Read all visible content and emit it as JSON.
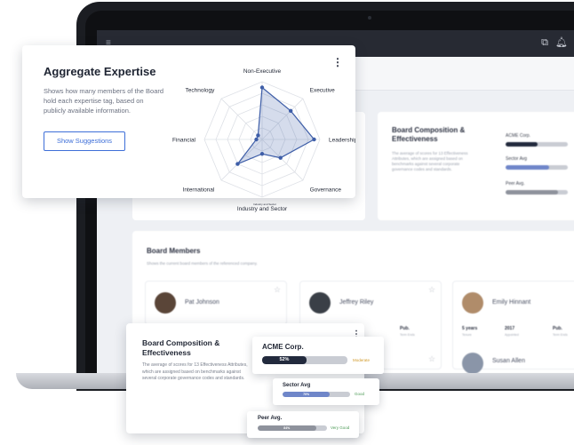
{
  "expertise_card": {
    "title": "Aggregate Expertise",
    "description": "Shows how many members of the Board hold each expertise tag, based on publicly available information.",
    "button_label": "Show Suggestions",
    "axes": [
      "Non-Executive",
      "Executive",
      "Leadership",
      "Governance",
      "Industry and Sector",
      "International",
      "Financial",
      "Technology"
    ],
    "axis_values": [
      0.9,
      0.7,
      0.9,
      0.45,
      0.25,
      0.6,
      0.1,
      0.1
    ],
    "fill_color": "#3e5ea8",
    "small_caption": "Industry and Sector"
  },
  "bg_composition": {
    "title": "Board Composition & Effectiveness",
    "description": "The average of scores for 13 Effectiveness Attributes, which are assigned based on benchmarks against several corporate governance codes and standards.",
    "rows": [
      {
        "label": "ACME Corp.",
        "value": "52%",
        "fraction": 0.52,
        "color": "#222a3d"
      },
      {
        "label": "Sector Avg",
        "value": "70%",
        "fraction": 0.7,
        "color": "#6f86c9"
      },
      {
        "label": "Peer Avg.",
        "value": "84%",
        "fraction": 0.84,
        "color": "#8e929c"
      }
    ]
  },
  "board_members": {
    "title": "Board Members",
    "description": "Shows the current board members of the referenced company.",
    "members": [
      {
        "name": "Pat Johnson",
        "avatar_color": "#5a4538"
      },
      {
        "name": "Jeffrey Riley",
        "avatar_color": "#3a3f47"
      },
      {
        "name": "Emily Hinnant",
        "avatar_color": "#b08c6a"
      }
    ],
    "stats": [
      {
        "value": "5 years",
        "label": "Tenure"
      },
      {
        "value": "2017",
        "label": "Appointed"
      },
      {
        "value": "Pub.",
        "label": "Term Ends"
      }
    ],
    "partial_stat": {
      "value": "Pub.",
      "label": "Term Ends"
    },
    "partial_name": "Susan Allen"
  },
  "composition_card": {
    "title": "Board Composition & Effectiveness",
    "description": "The average of scores for 13 Effectiveness Attributes, which are assigned based on benchmarks against several corporate governance codes and standards.",
    "acme": {
      "label": "ACME Corp.",
      "value": "52%",
      "fraction": 0.52,
      "status": "Moderate",
      "color": "#222a3d",
      "status_color": "#d19a2a"
    },
    "sector": {
      "label": "Sector Avg",
      "value": "70%",
      "fraction": 0.7,
      "status": "Good",
      "color": "#6f86c9",
      "status_color": "#4b9a55"
    },
    "peer": {
      "label": "Peer Avg.",
      "value": "84%",
      "fraction": 0.84,
      "status": "Very Good",
      "color": "#8e929c",
      "status_color": "#4b9a55"
    }
  },
  "icons": {
    "menu": "hamburger-icon",
    "copy": "copy-icon",
    "bell": "bell-icon",
    "user": "user-icon",
    "more": "kebab-icon",
    "star": "star-icon"
  }
}
